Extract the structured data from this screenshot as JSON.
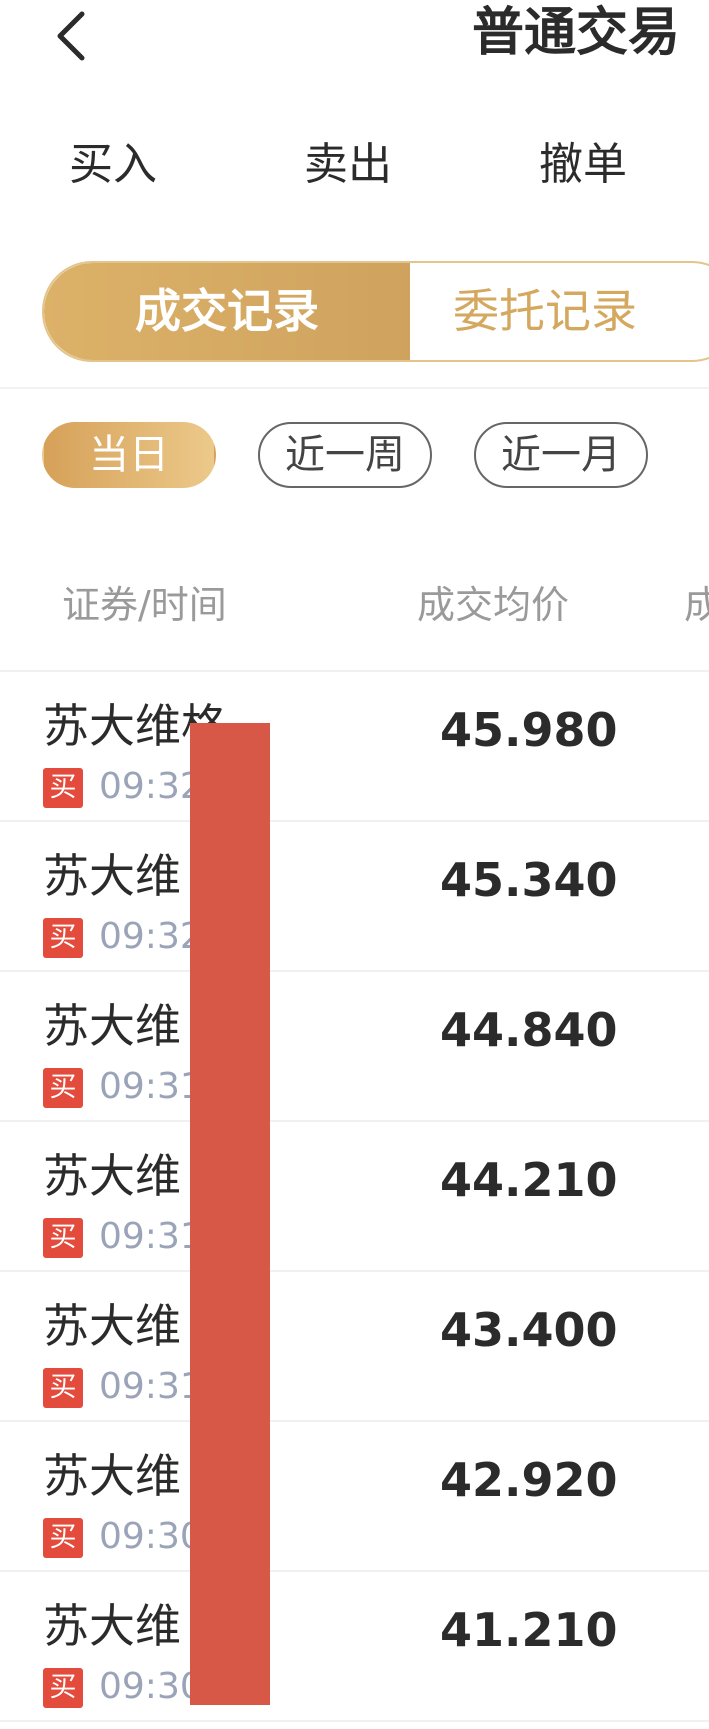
{
  "header": {
    "back_icon": "chevron-left-icon",
    "title": "普通交易"
  },
  "top_tabs": [
    "买入",
    "卖出",
    "撤单"
  ],
  "segment": {
    "active": "成交记录",
    "inactive": "委托记录"
  },
  "filters": {
    "today": "当日",
    "week": "近一周",
    "month": "近一月"
  },
  "columns": {
    "security_time": "证券/时间",
    "avg_price": "成交均价",
    "partial": "成"
  },
  "records": [
    {
      "name": "苏大维格",
      "side": "买",
      "time": "09:32",
      "price": "45.980"
    },
    {
      "name": "苏大维",
      "side": "买",
      "time": "09:32",
      "price": "45.340"
    },
    {
      "name": "苏大维",
      "side": "买",
      "time": "09:31",
      "price": "44.840"
    },
    {
      "name": "苏大维",
      "side": "买",
      "time": "09:31",
      "price": "44.210"
    },
    {
      "name": "苏大维",
      "side": "买",
      "time": "09:31",
      "price": "43.400"
    },
    {
      "name": "苏大维",
      "side": "买",
      "time": "09:30",
      "price": "42.920"
    },
    {
      "name": "苏大维",
      "side": "买",
      "time": "09:30",
      "price": "41.210"
    }
  ],
  "colors": {
    "accent_gold": "#d4a85f",
    "buy_red": "#e34b3c",
    "redaction": "#d85848"
  }
}
